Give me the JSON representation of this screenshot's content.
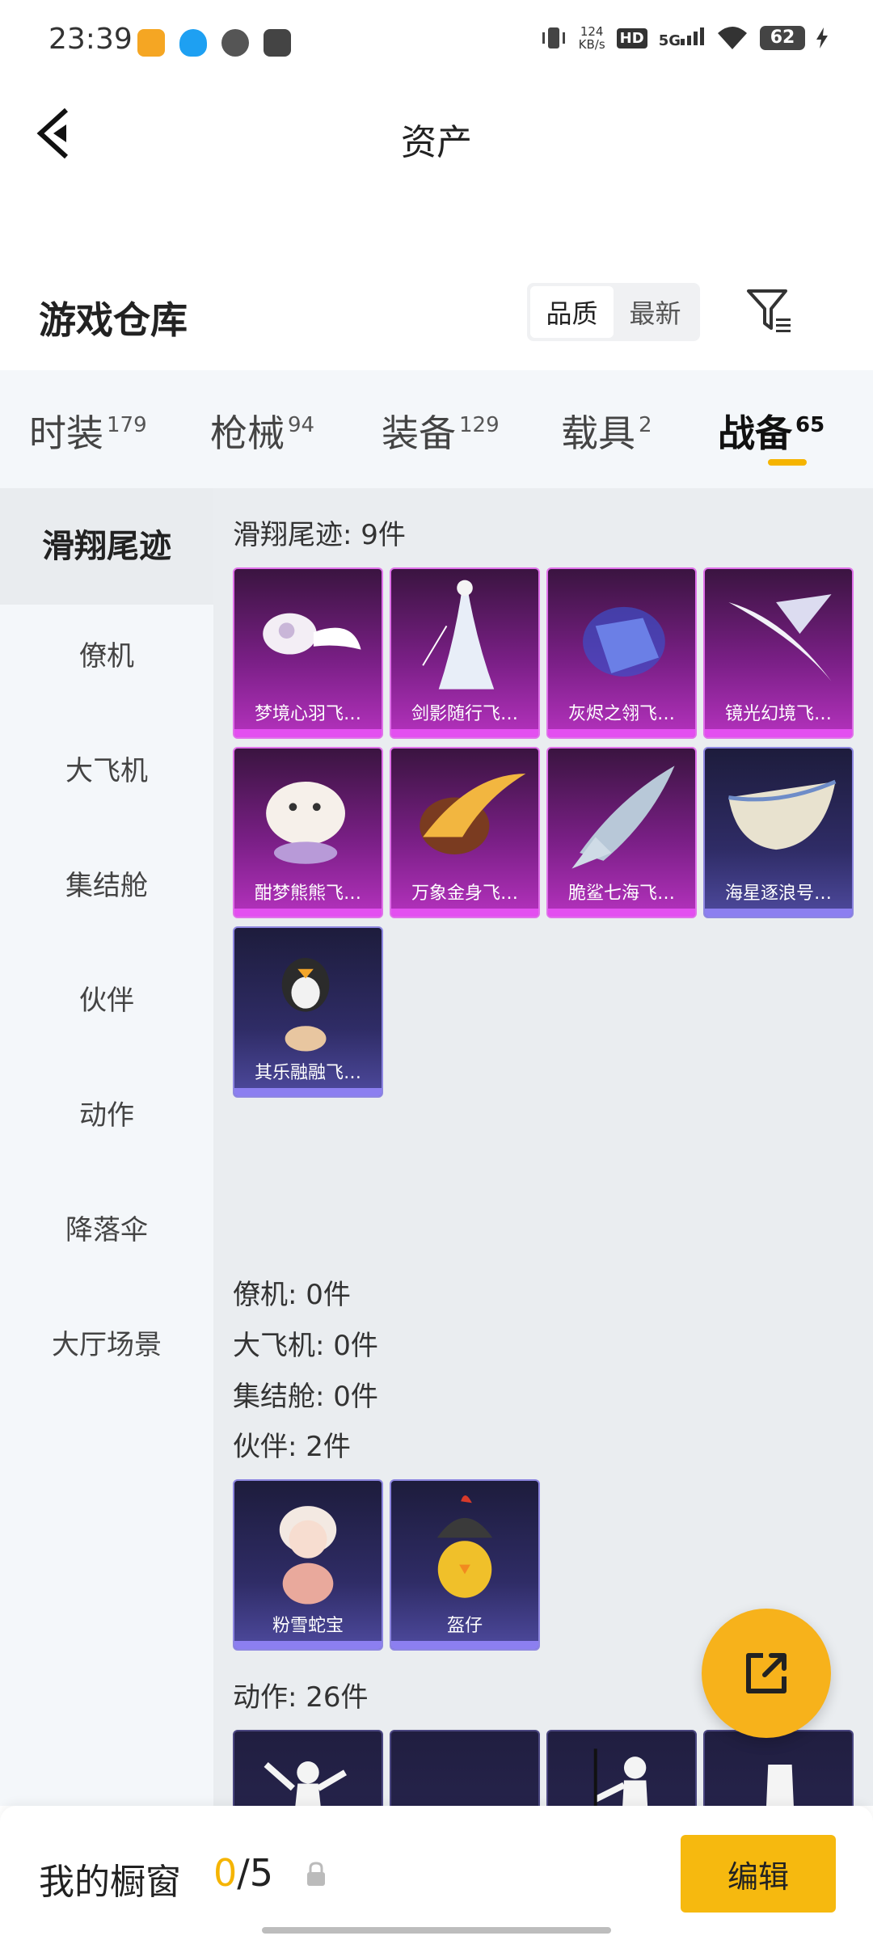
{
  "status_bar": {
    "time": "23:39",
    "net_speed_value": "124",
    "net_speed_unit": "KB/s",
    "hd": "HD",
    "network": "5G",
    "battery": "62"
  },
  "header": {
    "title": "资产"
  },
  "warehouse": {
    "title": "游戏仓库",
    "sort_options": [
      "品质",
      "最新"
    ],
    "active_sort": "品质"
  },
  "tabs": [
    {
      "label": "时装",
      "count": "179"
    },
    {
      "label": "枪械",
      "count": "94"
    },
    {
      "label": "装备",
      "count": "129"
    },
    {
      "label": "载具",
      "count": "2"
    },
    {
      "label": "战备",
      "count": "65"
    }
  ],
  "sidebar": {
    "items": [
      "滑翔尾迹",
      "僚机",
      "大飞机",
      "集结舱",
      "伙伴",
      "动作",
      "降落伞",
      "大厅场景"
    ]
  },
  "groups": {
    "glide_trail": {
      "label": "滑翔尾迹: 9件",
      "items": [
        "梦境心羽飞…",
        "剑影随行飞…",
        "灰烬之翎飞…",
        "镜光幻境飞…",
        "酣梦熊熊飞…",
        "万象金身飞…",
        "脆鲨七海飞…",
        "海星逐浪号…",
        "其乐融融飞…"
      ]
    },
    "wingman": {
      "label": "僚机: 0件"
    },
    "plane": {
      "label": "大飞机: 0件"
    },
    "pod": {
      "label": "集结舱: 0件"
    },
    "companion": {
      "label": "伙伴: 2件",
      "items": [
        "粉雪蛇宝",
        "盔仔"
      ]
    },
    "action": {
      "label": "动作: 26件"
    }
  },
  "bottom": {
    "showcase_label": "我的橱窗",
    "showcase_current": "0",
    "showcase_total": "/5",
    "edit_label": "编辑"
  },
  "colors": {
    "accent": "#f5b400",
    "legendary": "#e34ff0",
    "epic": "#8c7ff0"
  }
}
